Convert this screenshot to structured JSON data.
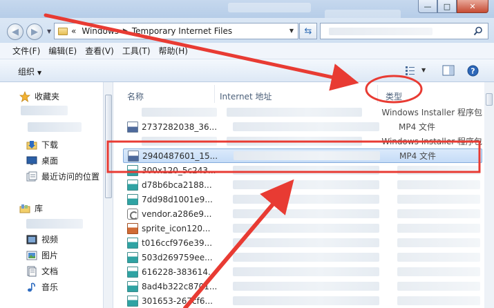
{
  "window": {
    "minimize_glyph": "—",
    "maximize_glyph": "□",
    "close_glyph": "✕"
  },
  "address": {
    "overflow": "«",
    "crumbs": [
      "Windows",
      "Temporary Internet Files"
    ],
    "separator": "▶"
  },
  "menu": {
    "items": [
      "文件(F)",
      "编辑(E)",
      "查看(V)",
      "工具(T)",
      "帮助(H)"
    ]
  },
  "toolbar": {
    "organize_label": "组织",
    "dropdown_glyph": "▼",
    "help_glyph": "?"
  },
  "sidebar": {
    "favorites_label": "收藏夹",
    "favorites_items": [
      "下载",
      "桌面",
      "最近访问的位置"
    ],
    "libraries_label": "库",
    "libraries_items": [
      "视频",
      "图片",
      "文档",
      "音乐"
    ]
  },
  "columns": {
    "name": "名称",
    "url": "Internet 地址",
    "type": "类型"
  },
  "files": [
    {
      "name": "",
      "type": "Windows Installer 程序包",
      "icon": "blank"
    },
    {
      "name": "2737282038_36...",
      "type": "MP4 文件",
      "icon": "mp4"
    },
    {
      "name": "",
      "type": "Windows Installer 程序包",
      "icon": "blank"
    },
    {
      "name": "2940487601_15...",
      "type": "MP4 文件",
      "icon": "mp4",
      "selected": true
    },
    {
      "name": "300x120_5c243...",
      "type": "",
      "icon": "gif"
    },
    {
      "name": "d78b6bca2188...",
      "type": "",
      "icon": "gif"
    },
    {
      "name": "7dd98d1001e9...",
      "type": "",
      "icon": "gif"
    },
    {
      "name": "vendor.a286e9...",
      "type": "",
      "icon": "js"
    },
    {
      "name": "sprite_icon120...",
      "type": "",
      "icon": "png"
    },
    {
      "name": "t016ccf976e39...",
      "type": "",
      "icon": "gif"
    },
    {
      "name": "503d269759ee...",
      "type": "",
      "icon": "gif"
    },
    {
      "name": "616228-383614...",
      "type": "",
      "icon": "gif"
    },
    {
      "name": "8ad4b322c8701...",
      "type": "",
      "icon": "gif"
    },
    {
      "name": "301653-267cf6...",
      "type": "",
      "icon": "gif"
    }
  ],
  "colors": {
    "annotation_red": "#e83b33",
    "selection_border": "#84acdd"
  }
}
